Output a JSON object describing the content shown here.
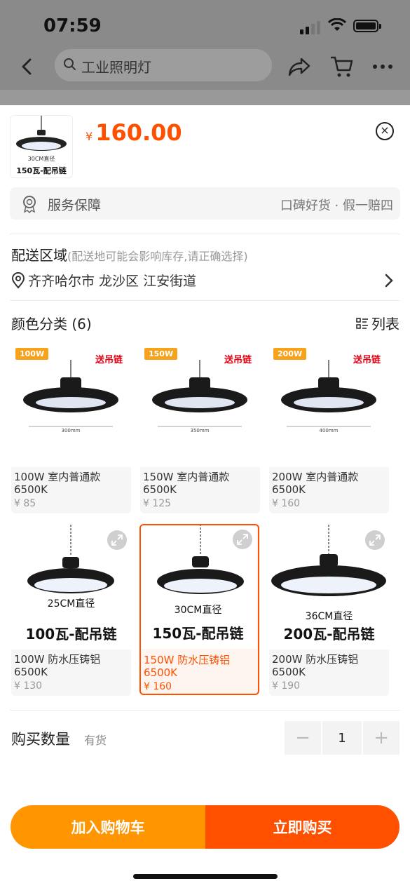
{
  "status_bar": {
    "time": "07:59"
  },
  "nav": {
    "search_text": "工业照明灯"
  },
  "sheet": {
    "thumb_caption_small": "30CM直径",
    "thumb_caption": "150瓦-配吊链",
    "price_currency": "¥",
    "price": "160.00",
    "service": {
      "label": "服务保障",
      "right": "口碑好货 · 假一赔四"
    },
    "delivery": {
      "title": "配送区域",
      "note": "(配送地可能会影响库存,请正确选择)",
      "address": "齐齐哈尔市 龙沙区 江安街道"
    },
    "color": {
      "title": "颜色分类 (6)",
      "list_view": "列表"
    },
    "variants": [
      {
        "badge": "100W",
        "tag": "送吊链",
        "dim": "300mm",
        "title": "100W 室内普通款",
        "sub": "6500K",
        "price": "¥ 85",
        "selected": false
      },
      {
        "badge": "150W",
        "tag": "送吊链",
        "dim": "350mm",
        "title": "150W 室内普通款",
        "sub": "6500K",
        "price": "¥ 125",
        "selected": false
      },
      {
        "badge": "200W",
        "tag": "送吊链",
        "dim": "400mm",
        "title": "200W 室内普通款",
        "sub": "6500K",
        "price": "¥ 160",
        "selected": false
      },
      {
        "diameter": "25CM直径",
        "caption": "100瓦-配吊链",
        "title": "100W 防水压铸铝",
        "sub": "6500K",
        "price": "¥ 130",
        "selected": false
      },
      {
        "diameter": "30CM直径",
        "caption": "150瓦-配吊链",
        "title": "150W 防水压铸铝",
        "sub": "6500K",
        "price": "¥ 160",
        "selected": true
      },
      {
        "diameter": "36CM直径",
        "caption": "200瓦-配吊链",
        "title": "200W 防水压铸铝",
        "sub": "6500K",
        "price": "¥ 190",
        "selected": false
      }
    ],
    "quantity": {
      "label": "购买数量",
      "stock": "有货",
      "value": "1",
      "minus": "−",
      "plus": "+"
    },
    "buttons": {
      "add_cart": "加入购物车",
      "buy_now": "立即购买"
    }
  },
  "colors": {
    "accent": "#ff5000",
    "cart_button": "#ff9500",
    "badge": "#f7a21b"
  }
}
